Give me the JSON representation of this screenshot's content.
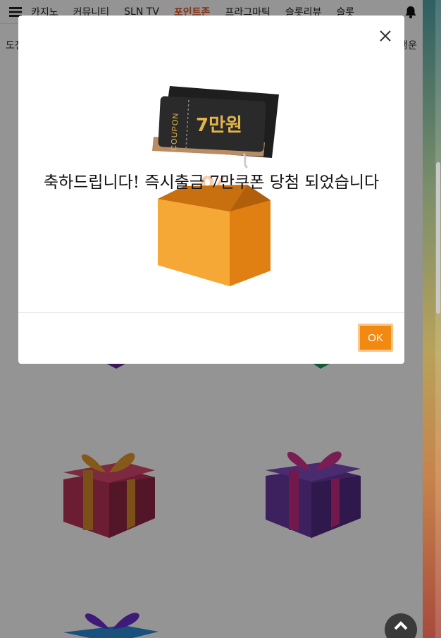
{
  "topnav": {
    "items": [
      {
        "label": "카지노"
      },
      {
        "label": "커뮤니티"
      },
      {
        "label": "SLN TV"
      },
      {
        "label": "포인트존",
        "active": true
      },
      {
        "label": "프라그마틱"
      },
      {
        "label": "슬롯리뷰"
      },
      {
        "label": "슬롯"
      }
    ],
    "menu_icon": "hamburger-icon",
    "bell_icon": "bell-icon"
  },
  "subnav": {
    "left_label": "도전",
    "right_label": "행운"
  },
  "modal": {
    "message": "축하드립니다! 즉시출금 7만쿠폰 당첨 되었습니다",
    "coupon_side_label": "COUPON",
    "coupon_amount": "7만원",
    "ok_label": "OK",
    "close_icon": "close-icon"
  },
  "colors": {
    "accent": "#e8521e",
    "ok_button": "#f28a12",
    "box_orange": "#f29a1e",
    "coupon_dark": "#2a2a2a",
    "coupon_gold": "#e3b44a"
  },
  "scroll_top_icon": "chevron-up-icon"
}
